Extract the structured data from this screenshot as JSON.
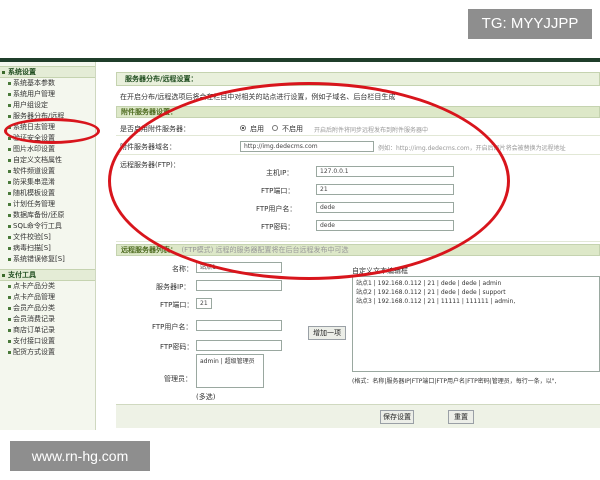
{
  "watermark_top": "TG: MYYJJPP",
  "watermark_bottom": "www.rn-hg.com",
  "sidebar": {
    "section1": "系统设置",
    "items1": [
      "系统基本参数",
      "系统用户管理",
      "用户组设定",
      "服务器分布/远程",
      "系统日志管理",
      "验证安全设置",
      "图片水印设置",
      "自定义文档属性",
      "软件频道设置",
      "防采集串混淆",
      "随机模板设置",
      "计划任务管理",
      "数据库备份/还原",
      "SQL命令行工具",
      "文件校验[S]",
      "病毒扫描[S]",
      "系统错误修复[S]"
    ],
    "section2": "支付工具",
    "items2": [
      "点卡产品分类",
      "点卡产品管理",
      "会员产品分类",
      "会员消费记录",
      "商店订单记录",
      "支付接口设置",
      "配货方式设置"
    ]
  },
  "main": {
    "title": "服务器分布/远程设置：",
    "desc": "在开启分布/远程选项后将会在栏目中对相关的站点进行设置，例如子域名、后台栏目生成",
    "attach_section": "附件服务器设置：",
    "enable_label": "是否启用附件服务器：",
    "enable_on": "启用",
    "enable_off": "不启用",
    "enable_hint": "开启后附件将同步远程发布到附件服务器中",
    "domain_label": "附件服务器域名：",
    "domain_value": "http://img.dedecms.com",
    "domain_hint": "例如：http://img.dedecms.com，开启后图片将会被替换为远程地址",
    "remote_label": "远程服务器(FTP)：",
    "host_label": "主机IP：",
    "host_value": "127.0.0.1",
    "port_label": "FTP端口：",
    "port_value": "21",
    "user_label": "FTP用户名：",
    "user_value": "dede",
    "pwd_label": "FTP密码：",
    "pwd_value": "dede",
    "list_section": "远程服务器列表：",
    "list_hint": "(FTP模式) 远程的服务器配置将在后台远程发布中可选",
    "name_label": "名称：",
    "name_value": "站点1",
    "ip_label": "服务器IP：",
    "ip_value": "",
    "fport_label": "FTP端口：",
    "fport_value": "21",
    "fuser_label": "FTP用户名：",
    "fuser_value": "",
    "fpwd_label": "FTP密码：",
    "fpwd_value": "",
    "admin_label": "管理员：",
    "admin_value": "admin | 超级管理员",
    "multi_hint": "(多选)",
    "add_button": "增加一项",
    "custom_title": "自定义文本编辑框",
    "custom_text": "站点1 | 192.168.0.112 | 21 | dede | dede | admin\n站点2 | 192.168.0.112 | 21 | dede | dede | support\n站点3 | 192.168.0.112 | 21 | 11111 | 111111 | admin,",
    "format_hint": "(格式：名称|服务器IP|FTP端口|FTP用户名|FTP密码|管理员，每行一条，以\",",
    "save_button": "保存设置",
    "reset_button": "重置"
  },
  "colors": {
    "highlight": "#d8151c",
    "section_bg": "#dde8c8"
  }
}
